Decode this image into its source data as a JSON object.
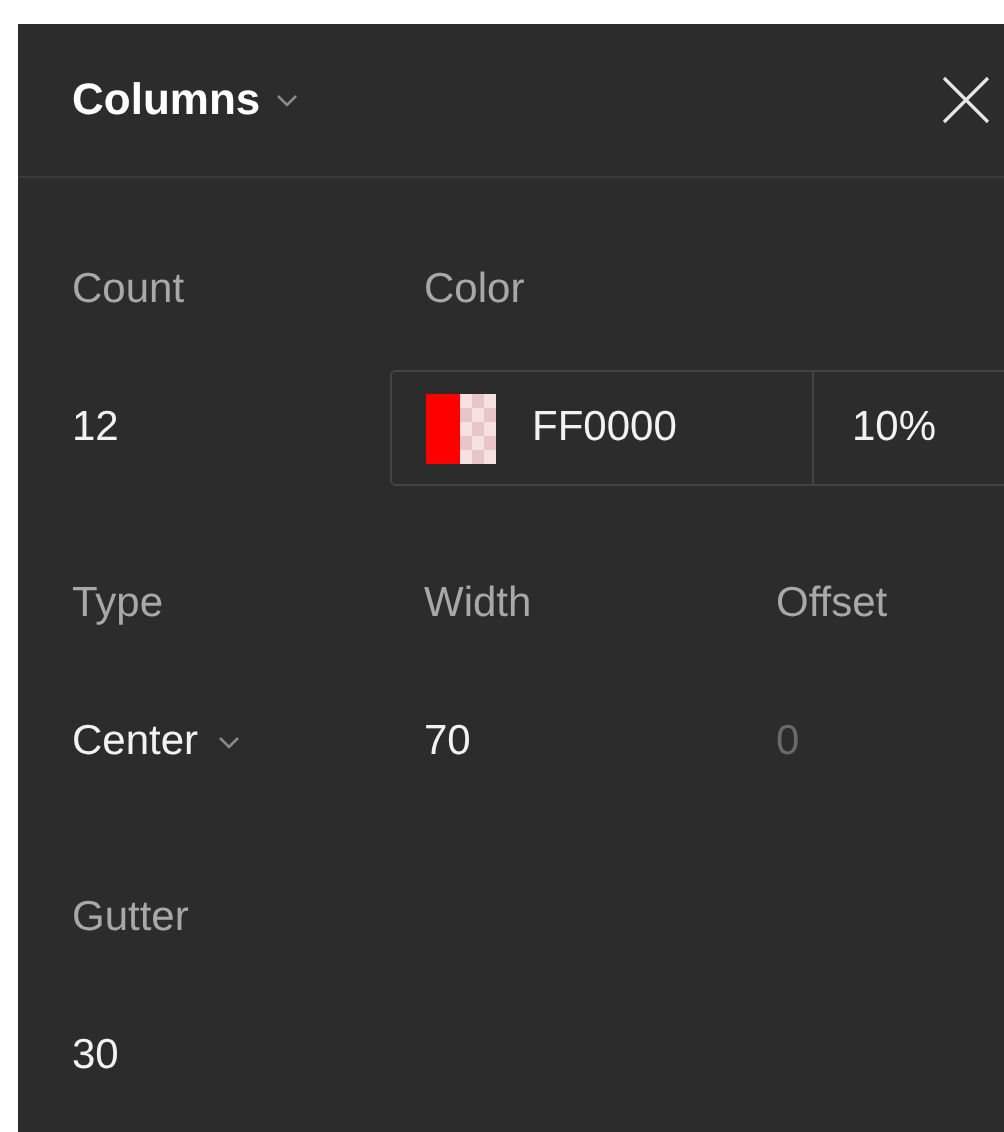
{
  "panel": {
    "title": "Columns"
  },
  "rows": [
    [
      {
        "kind": "number",
        "label": "Count",
        "value": "12",
        "disabled": false
      },
      {
        "kind": "color",
        "label": "Color",
        "hex": "FF0000",
        "opacity": "10%",
        "color": "#ff0000",
        "disabled": false
      }
    ],
    [
      {
        "kind": "dropdown",
        "label": "Type",
        "value": "Center",
        "disabled": false
      },
      {
        "kind": "number",
        "label": "Width",
        "value": "70",
        "disabled": false
      },
      {
        "kind": "number",
        "label": "Offset",
        "value": "0",
        "disabled": true
      }
    ],
    [
      {
        "kind": "number",
        "label": "Gutter",
        "value": "30",
        "disabled": false
      }
    ]
  ]
}
